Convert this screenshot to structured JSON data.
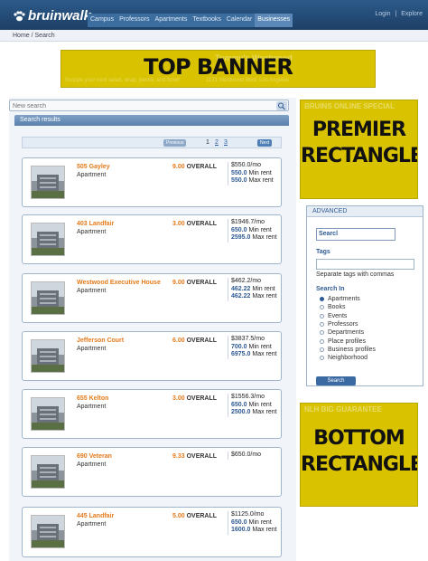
{
  "app": {
    "logo_text": "bruinwalk",
    "nav_tabs": [
      {
        "label": "Campus"
      },
      {
        "label": "Professors"
      },
      {
        "label": "Apartments"
      },
      {
        "label": "Textbooks"
      },
      {
        "label": "Calendar"
      },
      {
        "label": "Businesses"
      }
    ],
    "login_label": "Login",
    "sep": "|",
    "explore_label": "Explore"
  },
  "breadcrumb": "Home / Search",
  "banners": {
    "top_label": "TOP BANNER",
    "top_ghost_line1": "Tommy's Westwood",
    "top_ghost_line2": "Scoops your next salad, wrap, panini, and bowl!",
    "top_ghost_addr": "1121 Westwood Blvd, Los Angeles",
    "premier_line1": "PREMIER",
    "premier_line2": "RECTANGLE",
    "premier_ghost": "BRUINS ONLINE SPECIAL",
    "bottom_line1": "BOTTOM",
    "bottom_line2": "RECTANGLE",
    "bottom_ghost": "NLH BIG GUARANTEE"
  },
  "search": {
    "placeholder": "New search",
    "results_header": "Search results"
  },
  "pager": {
    "prev": "Previous",
    "pages": [
      "1",
      "2",
      "3"
    ],
    "next": "Next"
  },
  "results": [
    {
      "name": "505 Gayley",
      "type": "Apartment",
      "rating": "9.00",
      "rating_label": "OVERALL",
      "price": "$550.0/mo",
      "min": "550.0",
      "min_label": "Min rent",
      "max": "550.0",
      "max_label": "Max rent"
    },
    {
      "name": "403 Landfair",
      "type": "Apartment",
      "rating": "3.00",
      "rating_label": "OVERALL",
      "price": "$1946.7/mo",
      "min": "650.0",
      "min_label": "Min rent",
      "max": "2595.0",
      "max_label": "Max rent"
    },
    {
      "name": "Westwood Executive House",
      "type": "Apartment",
      "rating": "9.00",
      "rating_label": "OVERALL",
      "price": "$462.2/mo",
      "min": "462.22",
      "min_label": "Min rent",
      "max": "462.22",
      "max_label": "Max rent"
    },
    {
      "name": "Jefferson Court",
      "type": "Apartment",
      "rating": "6.00",
      "rating_label": "OVERALL",
      "price": "$3837.5/mo",
      "min": "700.0",
      "min_label": "Min rent",
      "max": "6975.0",
      "max_label": "Max rent"
    },
    {
      "name": "655 Kelton",
      "type": "Apartment",
      "rating": "3.00",
      "rating_label": "OVERALL",
      "price": "$1556.3/mo",
      "min": "650.0",
      "min_label": "Min rent",
      "max": "2500.0",
      "max_label": "Max rent"
    },
    {
      "name": "690 Veteran",
      "type": "Apartment",
      "rating": "9.33",
      "rating_label": "OVERALL",
      "price": "$650.0/mo",
      "min": "",
      "min_label": "",
      "max": "",
      "max_label": ""
    },
    {
      "name": "445 Landfair",
      "type": "Apartment",
      "rating": "5.00",
      "rating_label": "OVERALL",
      "price": "$1125.0/mo",
      "min": "650.0",
      "min_label": "Min rent",
      "max": "1600.0",
      "max_label": "Max rent"
    }
  ],
  "advanced": {
    "header": "ADVANCED",
    "search_value": "Searcl",
    "tags_label": "Tags",
    "tags_hint": "Separate tags with commas",
    "search_in_label": "Search In",
    "options": [
      {
        "label": "Apartments",
        "checked": true
      },
      {
        "label": "Books",
        "checked": false
      },
      {
        "label": "Events",
        "checked": false
      },
      {
        "label": "Professors",
        "checked": false
      },
      {
        "label": "Departments",
        "checked": false
      },
      {
        "label": "Place profiles",
        "checked": false
      },
      {
        "label": "Business profiles",
        "checked": false
      },
      {
        "label": "Neighborhood",
        "checked": false
      }
    ],
    "button_label": "Search"
  },
  "colors": {
    "nav_bg": "#2c5a8a",
    "accent_orange": "#e57a1a",
    "link_blue": "#2f5a93",
    "ad_yellow": "#d9c300"
  }
}
